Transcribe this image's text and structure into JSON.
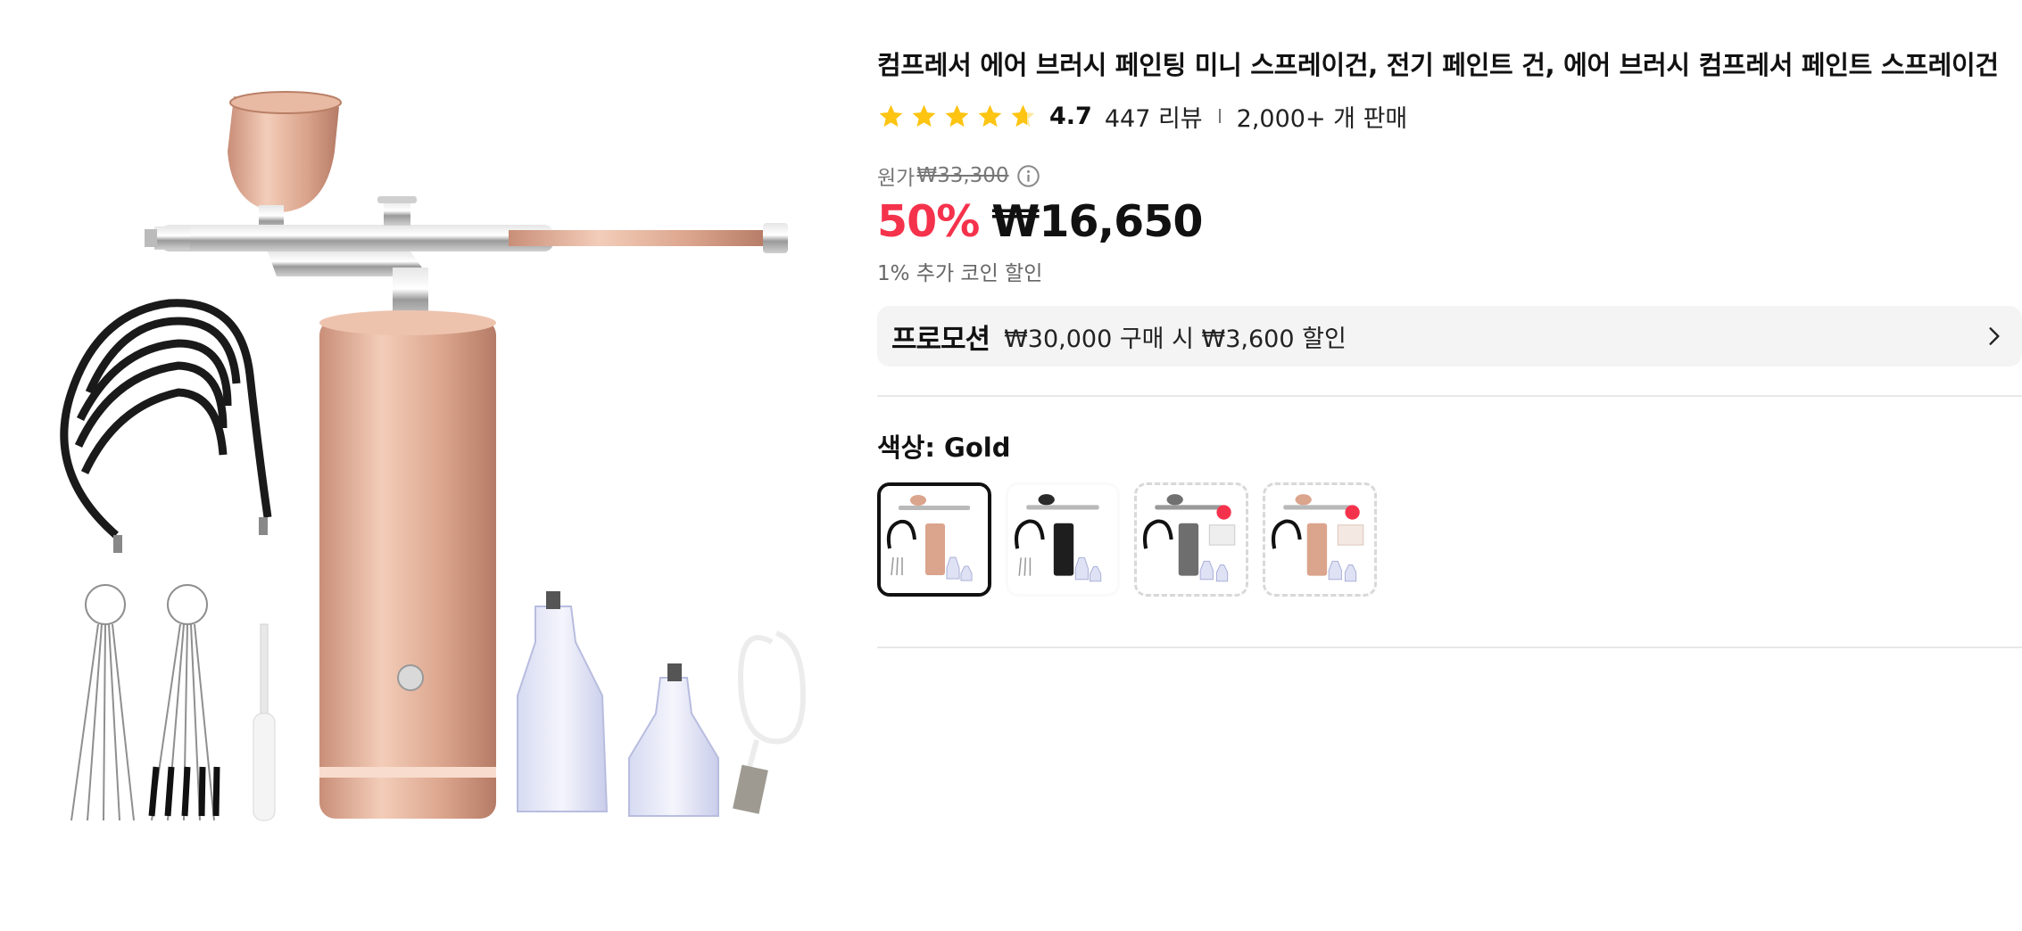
{
  "product": {
    "title": "컴프레서 에어 브러시 페인팅 미니 스프레이건, 전기 페인트 건, 에어 브러시 컴프레서 페인트 스프레이건",
    "rating": 4.7,
    "rating_text": "4.7",
    "reviews": "447 리뷰",
    "sold": "2,000+ 개 판매"
  },
  "pricing": {
    "original_label": "원가",
    "original_price": "₩33,300",
    "discount": "50%",
    "price": "₩16,650",
    "coin_discount": "1% 추가 코인 할인"
  },
  "promo": {
    "tag": "프로모션",
    "text": "₩30,000 구매 시 ₩3,600 할인"
  },
  "variant": {
    "label": "색상: Gold",
    "swatches": [
      {
        "name": "gold",
        "selected": true
      },
      {
        "name": "black",
        "selected": false
      },
      {
        "name": "gray-set",
        "selected": false
      },
      {
        "name": "gold-set",
        "selected": false
      }
    ]
  },
  "colors": {
    "accent_red": "#f5324c",
    "star_yellow": "#fdc412",
    "rose_gold": "#dba48c"
  },
  "icons": {
    "star": "star-icon",
    "info": "info-icon",
    "chevron": "chevron-right-icon"
  }
}
